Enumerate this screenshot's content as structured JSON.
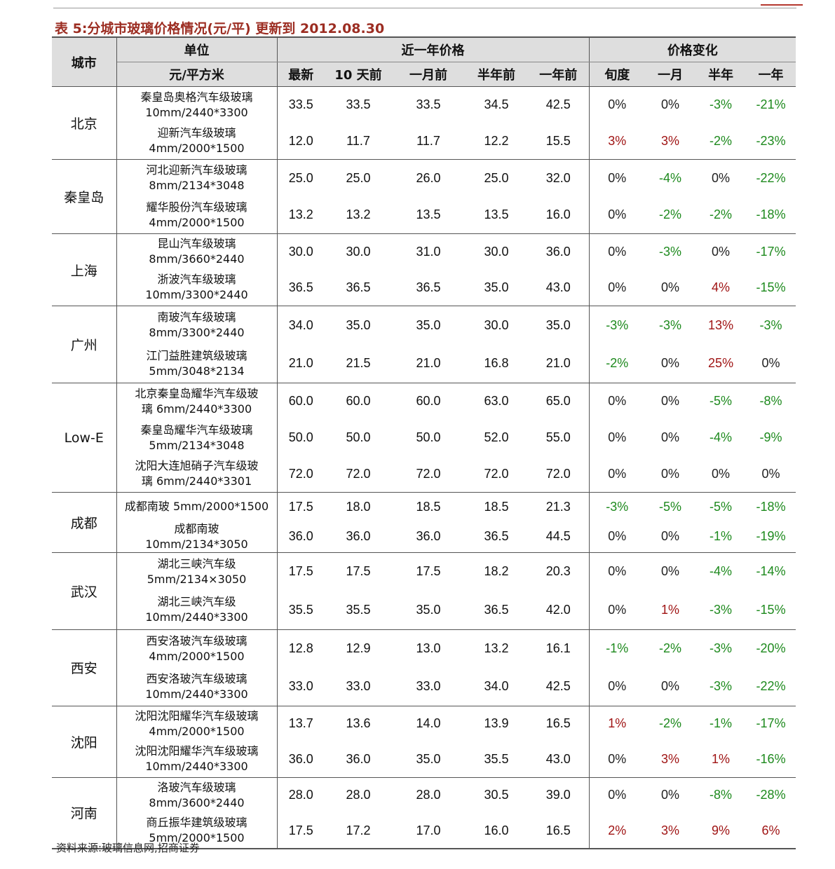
{
  "title": "表 5:分城市玻璃价格情况(元/平) 更新到 2012.08.30",
  "headers": {
    "city": "城市",
    "unit_top": "单位",
    "unit_sub": "元/平方米",
    "price_group": "近一年价格",
    "change_group": "价格变化",
    "price_cols": [
      "最新",
      "10 天前",
      "一月前",
      "半年前",
      "一年前"
    ],
    "change_cols": [
      "旬度",
      "一月",
      "半年",
      "一年"
    ]
  },
  "groups": [
    {
      "city": "北京",
      "rows": [
        {
          "unit": [
            "秦皇岛奥格汽车级玻璃",
            "10mm/2440*3300"
          ],
          "prices": [
            "33.5",
            "33.5",
            "33.5",
            "34.5",
            "42.5"
          ],
          "changes": [
            "0%",
            "0%",
            "-3%",
            "-21%"
          ]
        },
        {
          "unit": [
            "迎新汽车级玻璃",
            "4mm/2000*1500"
          ],
          "prices": [
            "12.0",
            "11.7",
            "11.7",
            "12.2",
            "15.5"
          ],
          "changes": [
            "3%",
            "3%",
            "-2%",
            "-23%"
          ]
        }
      ]
    },
    {
      "city": "秦皇岛",
      "rows": [
        {
          "unit": [
            "河北迎新汽车级玻璃",
            "8mm/2134*3048"
          ],
          "prices": [
            "25.0",
            "25.0",
            "26.0",
            "25.0",
            "32.0"
          ],
          "changes": [
            "0%",
            "-4%",
            "0%",
            "-22%"
          ]
        },
        {
          "unit": [
            "耀华股份汽车级玻璃",
            "4mm/2000*1500"
          ],
          "prices": [
            "13.2",
            "13.2",
            "13.5",
            "13.5",
            "16.0"
          ],
          "changes": [
            "0%",
            "-2%",
            "-2%",
            "-18%"
          ]
        }
      ]
    },
    {
      "city": "上海",
      "rows": [
        {
          "unit": [
            "昆山汽车级玻璃",
            "8mm/3660*2440"
          ],
          "prices": [
            "30.0",
            "30.0",
            "31.0",
            "30.0",
            "36.0"
          ],
          "changes": [
            "0%",
            "-3%",
            "0%",
            "-17%"
          ]
        },
        {
          "unit": [
            "浙波汽车级玻璃",
            "10mm/3300*2440"
          ],
          "prices": [
            "36.5",
            "36.5",
            "36.5",
            "35.0",
            "43.0"
          ],
          "changes": [
            "0%",
            "0%",
            "4%",
            "-15%"
          ]
        }
      ]
    },
    {
      "city": "广州",
      "rows": [
        {
          "unit": [
            "南玻汽车级玻璃",
            "8mm/3300*2440"
          ],
          "prices": [
            "34.0",
            "35.0",
            "35.0",
            "30.0",
            "35.0"
          ],
          "changes": [
            "-3%",
            "-3%",
            "13%",
            "-3%"
          ]
        },
        {
          "unit": [
            "江门益胜建筑级玻璃",
            "5mm/3048*2134"
          ],
          "prices": [
            "21.0",
            "21.5",
            "21.0",
            "16.8",
            "21.0"
          ],
          "changes": [
            "-2%",
            "0%",
            "25%",
            "0%"
          ]
        }
      ]
    },
    {
      "city": "Low-E",
      "rows": [
        {
          "unit": [
            "北京秦皇岛耀华汽车级玻",
            "璃 6mm/2440*3300"
          ],
          "prices": [
            "60.0",
            "60.0",
            "60.0",
            "63.0",
            "65.0"
          ],
          "changes": [
            "0%",
            "0%",
            "-5%",
            "-8%"
          ]
        },
        {
          "unit": [
            "秦皇岛耀华汽车级玻璃",
            "5mm/2134*3048"
          ],
          "prices": [
            "50.0",
            "50.0",
            "50.0",
            "52.0",
            "55.0"
          ],
          "changes": [
            "0%",
            "0%",
            "-4%",
            "-9%"
          ]
        },
        {
          "unit": [
            "沈阳大连旭硝子汽车级玻",
            "璃 6mm/2440*3301"
          ],
          "prices": [
            "72.0",
            "72.0",
            "72.0",
            "72.0",
            "72.0"
          ],
          "changes": [
            "0%",
            "0%",
            "0%",
            "0%"
          ]
        }
      ]
    },
    {
      "city": "成都",
      "rows": [
        {
          "unit": [
            "成都南玻 5mm/2000*1500"
          ],
          "prices": [
            "17.5",
            "18.0",
            "18.5",
            "18.5",
            "21.3"
          ],
          "changes": [
            "-3%",
            "-5%",
            "-5%",
            "-18%"
          ]
        },
        {
          "unit": [
            "成都南玻",
            "10mm/2134*3050"
          ],
          "prices": [
            "36.0",
            "36.0",
            "36.0",
            "36.5",
            "44.5"
          ],
          "changes": [
            "0%",
            "0%",
            "-1%",
            "-19%"
          ]
        }
      ]
    },
    {
      "city": "武汉",
      "rows": [
        {
          "unit": [
            "湖北三峡汽车级",
            "5mm/2134×3050"
          ],
          "prices": [
            "17.5",
            "17.5",
            "17.5",
            "18.2",
            "20.3"
          ],
          "changes": [
            "0%",
            "0%",
            "-4%",
            "-14%"
          ]
        },
        {
          "unit": [
            "湖北三峡汽车级",
            "10mm/2440*3300"
          ],
          "prices": [
            "35.5",
            "35.5",
            "35.0",
            "36.5",
            "42.0"
          ],
          "changes": [
            "0%",
            "1%",
            "-3%",
            "-15%"
          ]
        }
      ]
    },
    {
      "city": "西安",
      "rows": [
        {
          "unit": [
            "西安洛玻汽车级玻璃",
            "4mm/2000*1500"
          ],
          "prices": [
            "12.8",
            "12.9",
            "13.0",
            "13.2",
            "16.1"
          ],
          "changes": [
            "-1%",
            "-2%",
            "-3%",
            "-20%"
          ]
        },
        {
          "unit": [
            "西安洛玻汽车级玻璃",
            "10mm/2440*3300"
          ],
          "prices": [
            "33.0",
            "33.0",
            "33.0",
            "34.0",
            "42.5"
          ],
          "changes": [
            "0%",
            "0%",
            "-3%",
            "-22%"
          ]
        }
      ]
    },
    {
      "city": "沈阳",
      "rows": [
        {
          "unit": [
            "沈阳沈阳耀华汽车级玻璃",
            "4mm/2000*1500"
          ],
          "prices": [
            "13.7",
            "13.6",
            "14.0",
            "13.9",
            "16.5"
          ],
          "changes": [
            "1%",
            "-2%",
            "-1%",
            "-17%"
          ]
        },
        {
          "unit": [
            "沈阳沈阳耀华汽车级玻璃",
            "10mm/2440*3300"
          ],
          "prices": [
            "36.0",
            "36.0",
            "35.0",
            "35.5",
            "43.0"
          ],
          "changes": [
            "0%",
            "3%",
            "1%",
            "-16%"
          ]
        }
      ]
    },
    {
      "city": "河南",
      "rows": [
        {
          "unit": [
            "洛玻汽车级玻璃",
            "8mm/3600*2440"
          ],
          "prices": [
            "28.0",
            "28.0",
            "28.0",
            "30.5",
            "39.0"
          ],
          "changes": [
            "0%",
            "0%",
            "-8%",
            "-28%"
          ]
        },
        {
          "unit": [
            "商丘振华建筑级玻璃",
            "5mm/2000*1500"
          ],
          "prices": [
            "17.5",
            "17.2",
            "17.0",
            "16.0",
            "16.5"
          ],
          "changes": [
            "2%",
            "3%",
            "9%",
            "6%"
          ]
        }
      ]
    }
  ],
  "source": "资料来源:玻璃信息网,招商证券"
}
